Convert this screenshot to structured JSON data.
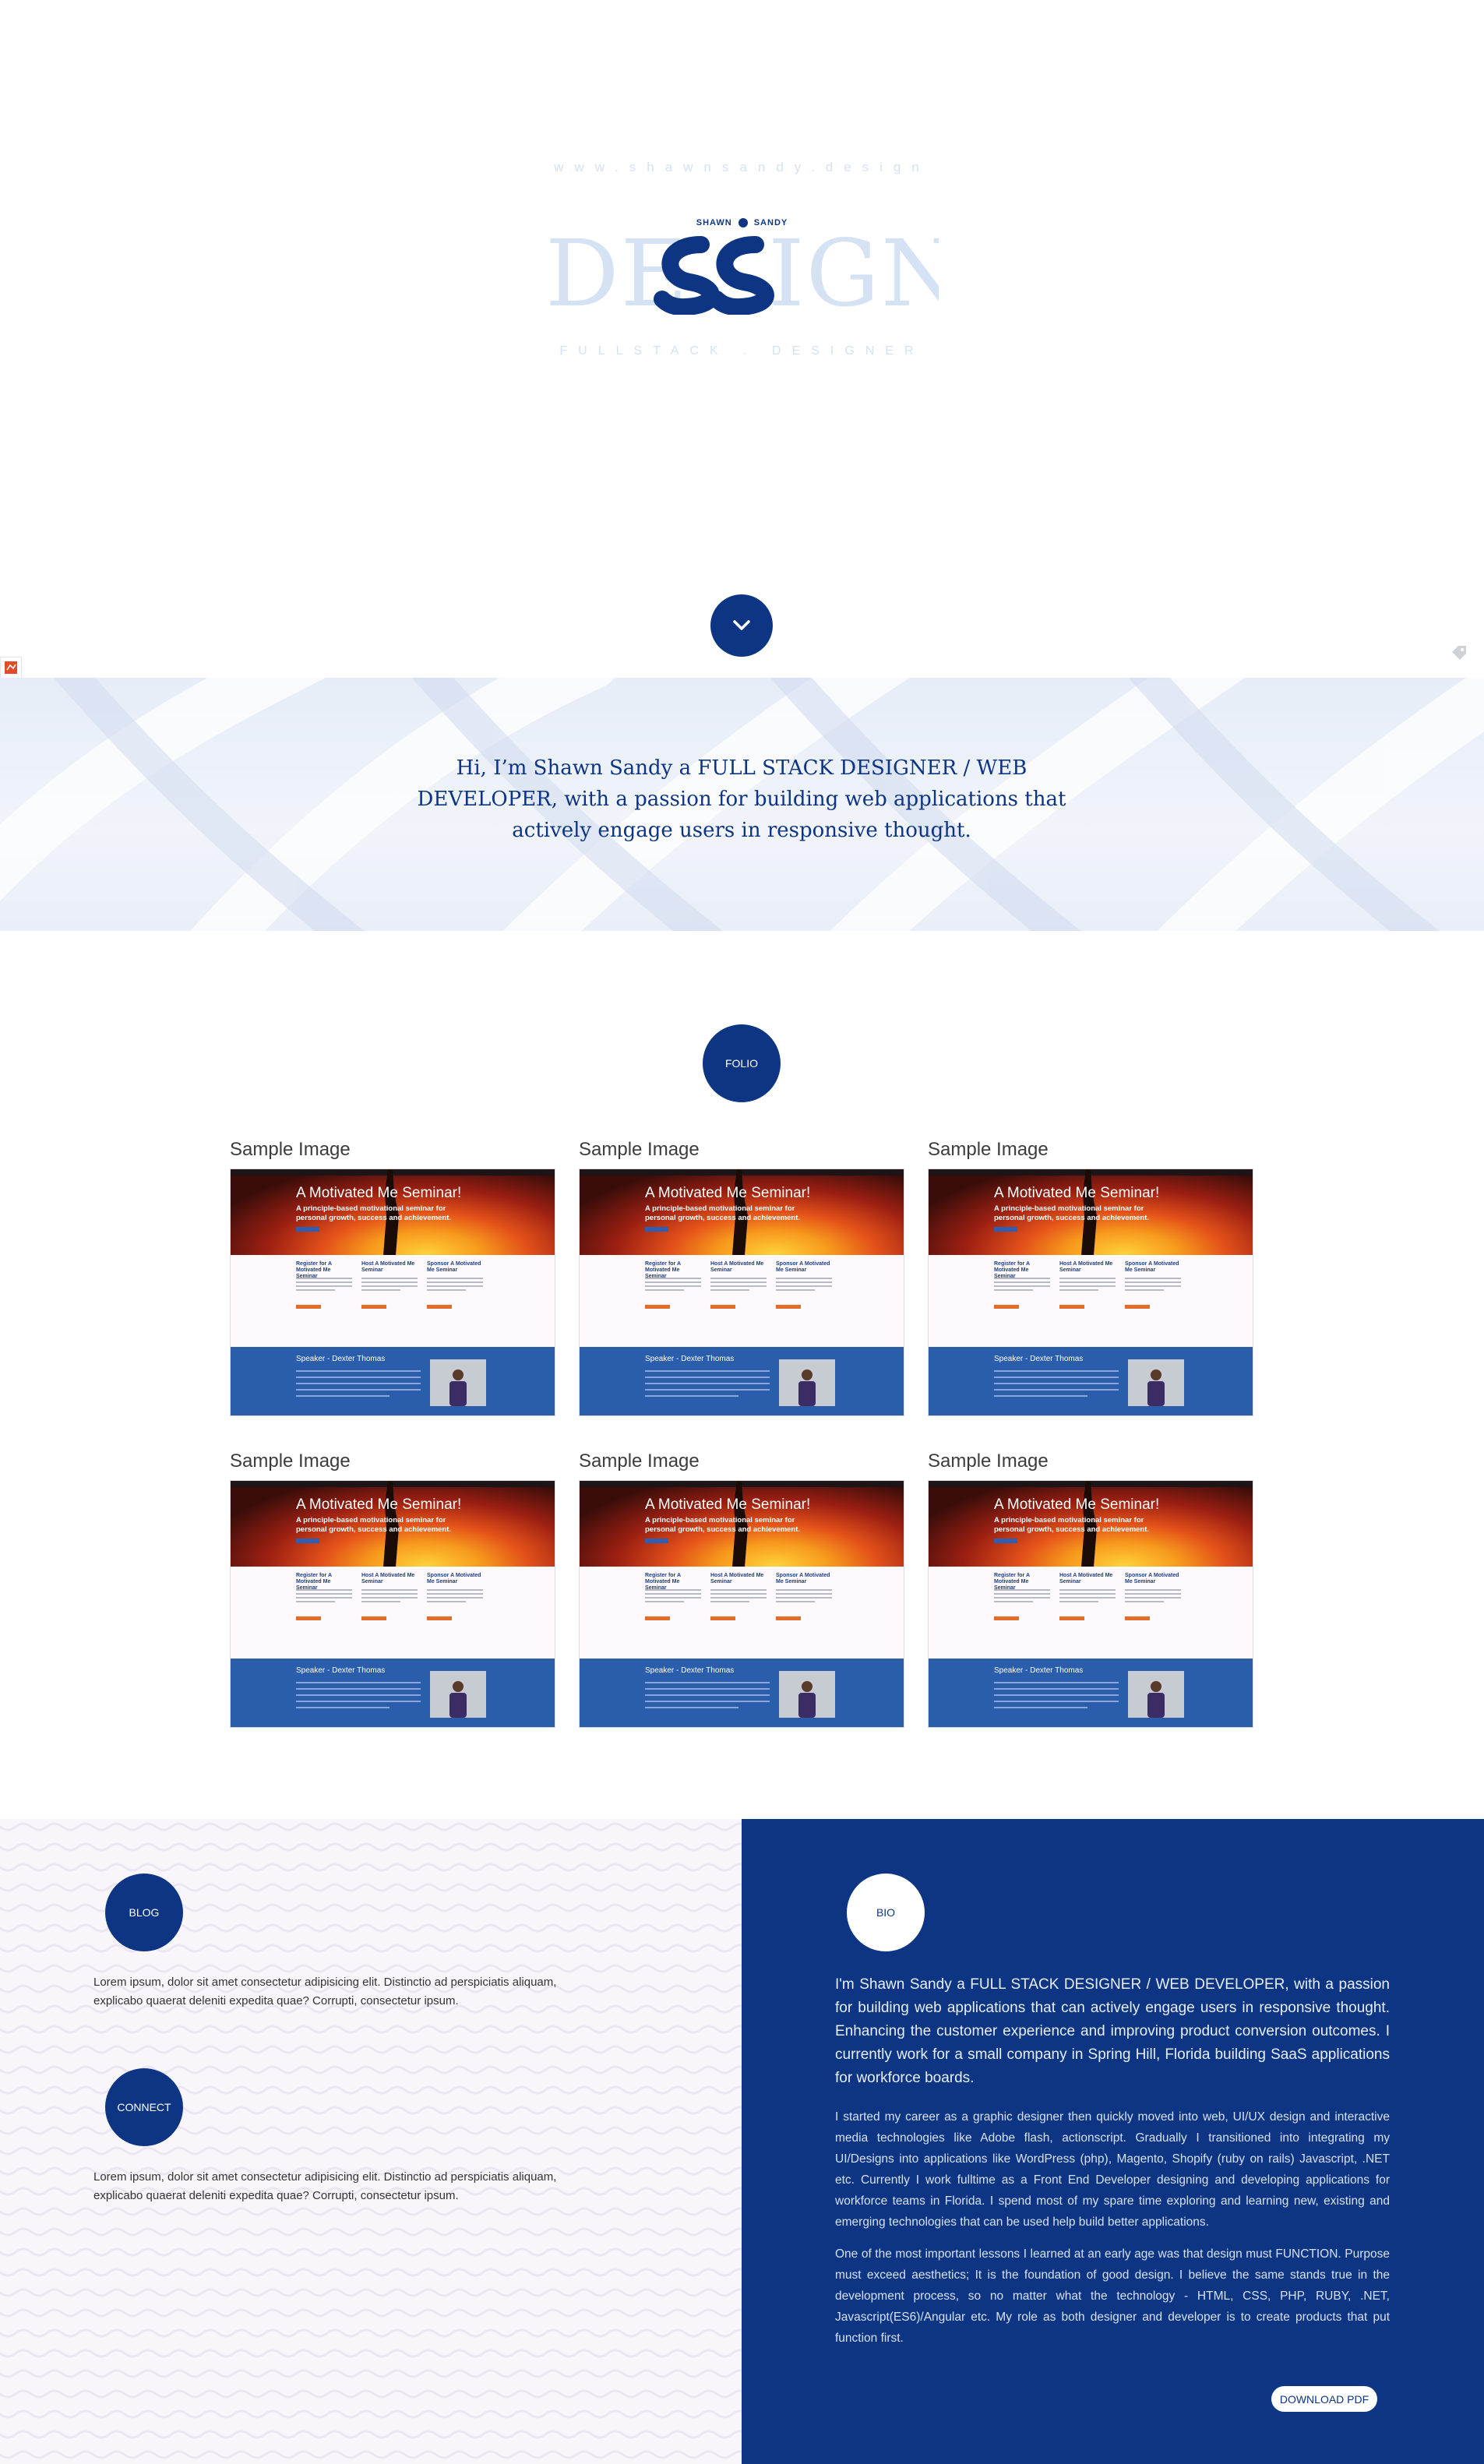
{
  "hero": {
    "site_url": "www.shawnsandy.design",
    "logo_first_name": "SHAWN",
    "logo_last_name": "SANDY",
    "logo_word": "DESSIGN",
    "tagline": "FULLSTACK . DESIGNER"
  },
  "intro": {
    "text": "Hi, I’m Shawn Sandy a FULL STACK DESIGNER / WEB DEVELOPER, with a passion for building web applications that actively engage users in responsive thought."
  },
  "folio": {
    "label": "FOLIO",
    "items": [
      {
        "title": "Sample Image",
        "shot": {
          "headline": "A Motivated Me Seminar!",
          "subhead": "A principle-based motivational seminar for personal growth, success and achievement.",
          "col1": "Register for A Motivated Me Seminar",
          "col2": "Host A Motivated Me Seminar",
          "col3": "Sponsor A Motivated Me Seminar",
          "speaker": "Speaker - Dexter Thomas"
        }
      },
      {
        "title": "Sample Image",
        "shot": {
          "headline": "A Motivated Me Seminar!",
          "subhead": "A principle-based motivational seminar for personal growth, success and achievement.",
          "col1": "Register for A Motivated Me Seminar",
          "col2": "Host A Motivated Me Seminar",
          "col3": "Sponsor A Motivated Me Seminar",
          "speaker": "Speaker - Dexter Thomas"
        }
      },
      {
        "title": "Sample Image",
        "shot": {
          "headline": "A Motivated Me Seminar!",
          "subhead": "A principle-based motivational seminar for personal growth, success and achievement.",
          "col1": "Register for A Motivated Me Seminar",
          "col2": "Host A Motivated Me Seminar",
          "col3": "Sponsor A Motivated Me Seminar",
          "speaker": "Speaker - Dexter Thomas"
        }
      },
      {
        "title": "Sample Image",
        "shot": {
          "headline": "A Motivated Me Seminar!",
          "subhead": "A principle-based motivational seminar for personal growth, success and achievement.",
          "col1": "Register for A Motivated Me Seminar",
          "col2": "Host A Motivated Me Seminar",
          "col3": "Sponsor A Motivated Me Seminar",
          "speaker": "Speaker - Dexter Thomas"
        }
      },
      {
        "title": "Sample Image",
        "shot": {
          "headline": "A Motivated Me Seminar!",
          "subhead": "A principle-based motivational seminar for personal growth, success and achievement.",
          "col1": "Register for A Motivated Me Seminar",
          "col2": "Host A Motivated Me Seminar",
          "col3": "Sponsor A Motivated Me Seminar",
          "speaker": "Speaker - Dexter Thomas"
        }
      },
      {
        "title": "Sample Image",
        "shot": {
          "headline": "A Motivated Me Seminar!",
          "subhead": "A principle-based motivational seminar for personal growth, success and achievement.",
          "col1": "Register for A Motivated Me Seminar",
          "col2": "Host A Motivated Me Seminar",
          "col3": "Sponsor A Motivated Me Seminar",
          "speaker": "Speaker - Dexter Thomas"
        }
      }
    ]
  },
  "blog": {
    "label": "BLOG",
    "text": "Lorem ipsum, dolor sit amet consectetur adipisicing elit. Distinctio ad perspiciatis aliquam, explicabo quaerat deleniti expedita quae? Corrupti, consectetur ipsum."
  },
  "connect": {
    "label": "CONNECT",
    "text": "Lorem ipsum, dolor sit amet consectetur adipisicing elit. Distinctio ad perspiciatis aliquam, explicabo quaerat deleniti expedita quae? Corrupti, consectetur ipsum."
  },
  "bio": {
    "label": "BIO",
    "lead": "I'm Shawn Sandy a FULL STACK DESIGNER / WEB DEVELOPER, with a passion for building web applications that can actively engage users in responsive thought. Enhancing the customer experience and improving product conversion outcomes. I currently work for a small company in Spring Hill, Florida building SaaS applications for workforce boards.",
    "paragraph1": "I started my career as a graphic designer then quickly moved into web, UI/UX design and interactive media technologies like Adobe flash, actionscript. Gradually I transitioned into integrating my UI/Designs into applications like WordPress (php), Magento, Shopify (ruby on rails) Javascript, .NET etc. Currently I work fulltime as a Front End Developer designing and developing applications for workforce teams in Florida. I spend most of my spare time exploring and learning new, existing and emerging technologies that can be used help build better applications.",
    "paragraph2": "One of the most important lessons I learned at an early age was that design must FUNCTION. Purpose must exceed aesthetics; It is the foundation of good design. I believe the same stands true in the development process, so no matter what the technology - HTML, CSS, PHP, RUBY, .NET, Javascript(ES6)/Angular etc. My role as both designer and developer is to create products that put function first.",
    "download_label": "DOWNLOAD PDF"
  },
  "colors": {
    "brand_blue": "#0d3584",
    "pale_blue": "#d5e2f3",
    "accent_orange": "#e56b2a"
  },
  "icons": {
    "scroll_down": "chevron-down-icon",
    "left_badge": "recaptcha-icon",
    "right_badge": "tag-icon"
  }
}
